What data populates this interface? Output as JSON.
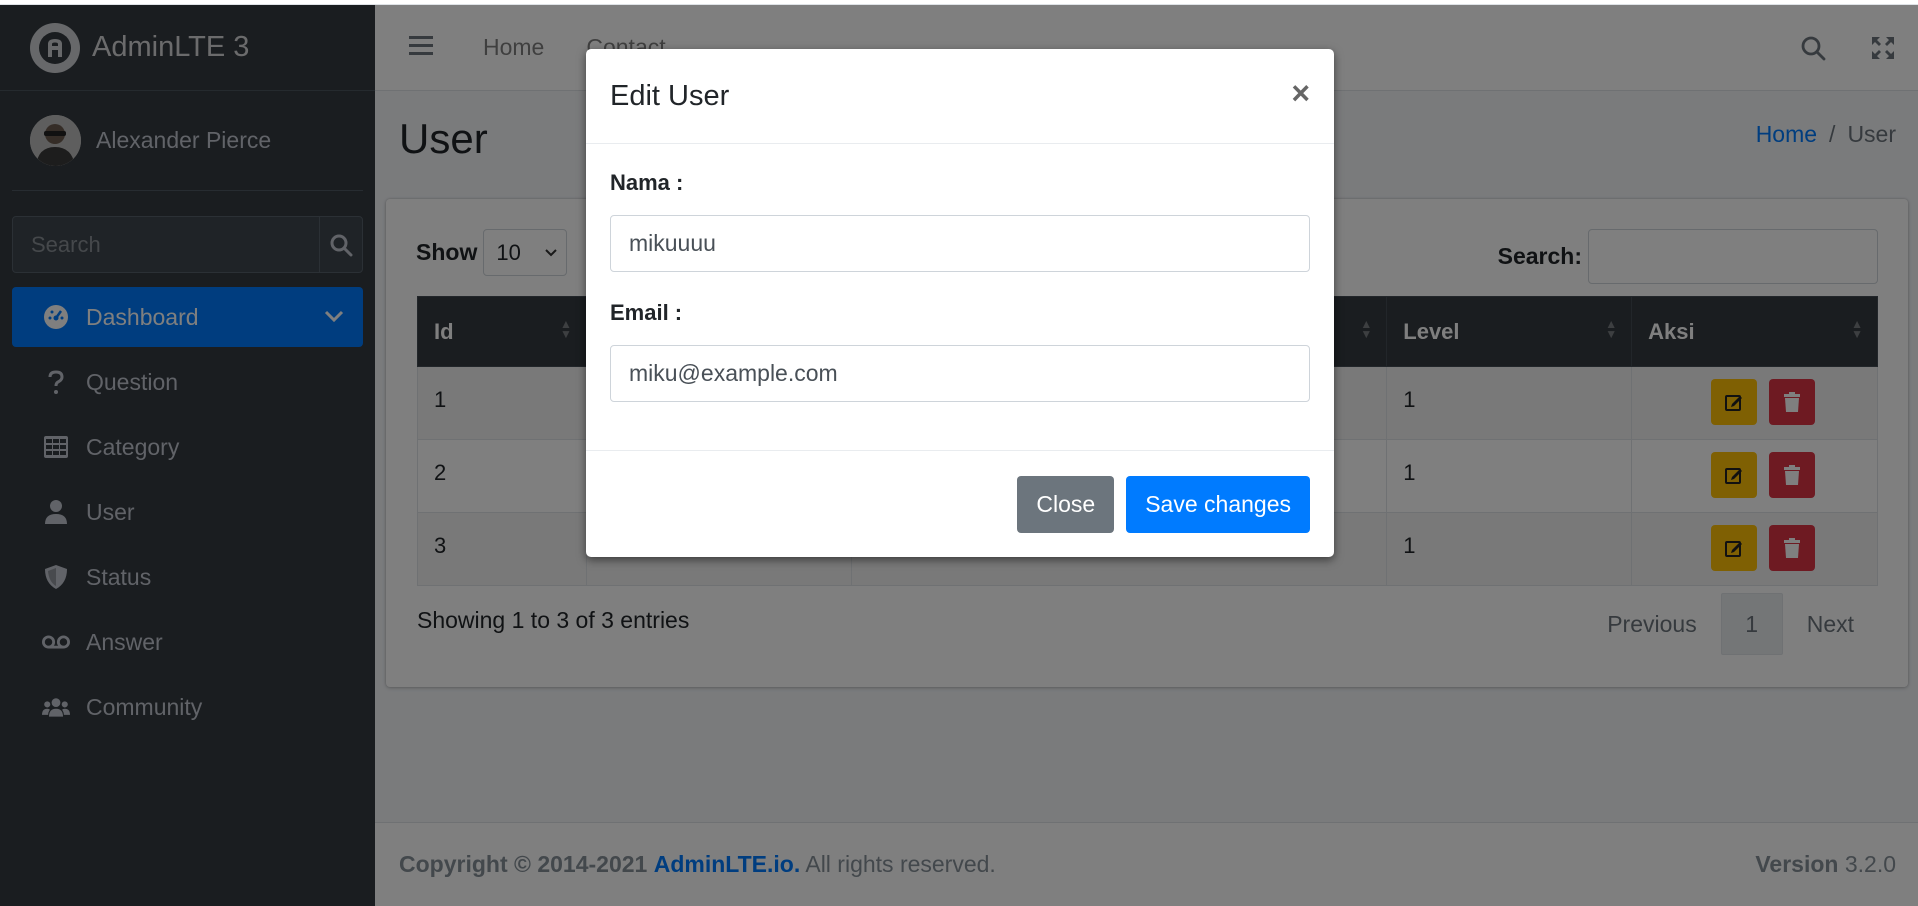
{
  "brand": {
    "name": "AdminLTE 3"
  },
  "user_panel": {
    "name": "Alexander Pierce"
  },
  "sidebar_search": {
    "placeholder": "Search"
  },
  "sidebar": {
    "items": [
      {
        "label": "Dashboard",
        "icon": "tachometer-icon",
        "active": true
      },
      {
        "label": "Question",
        "icon": "question-icon"
      },
      {
        "label": "Category",
        "icon": "table-icon"
      },
      {
        "label": "User",
        "icon": "user-icon"
      },
      {
        "label": "Status",
        "icon": "shield-icon"
      },
      {
        "label": "Answer",
        "icon": "voicemail-icon"
      },
      {
        "label": "Community",
        "icon": "users-icon"
      }
    ]
  },
  "navbar": {
    "home": "Home",
    "contact": "Contact"
  },
  "page": {
    "title": "User",
    "breadcrumb_home": "Home",
    "breadcrumb_current": "User"
  },
  "table_controls": {
    "show_label": "Show",
    "length_value": "10",
    "search_label": "Search:"
  },
  "table": {
    "columns": [
      "Id",
      "Level",
      "Aksi"
    ],
    "rows": [
      {
        "id": "1",
        "level": "1"
      },
      {
        "id": "2",
        "level": "1"
      },
      {
        "id": "3",
        "level": "1"
      }
    ]
  },
  "table_info": "Showing 1 to 3 of 3 entries",
  "pagination": {
    "previous": "Previous",
    "current": "1",
    "next": "Next"
  },
  "footer": {
    "copyright": "Copyright © 2014-2021",
    "link": "AdminLTE.io.",
    "rights": "All rights reserved.",
    "version_label": "Version",
    "version": "3.2.0"
  },
  "modal": {
    "title": "Edit User",
    "close_symbol": "×",
    "nama_label": "Nama :",
    "nama_value": "mikuuuu",
    "email_label": "Email :",
    "email_value": "miku@example.com",
    "close_button": "Close",
    "save_button": "Save changes"
  },
  "colors": {
    "primary": "#007bff",
    "warning": "#ffc107",
    "danger": "#dc3545",
    "sidebar": "#343a40",
    "secondary": "#6c757d"
  }
}
